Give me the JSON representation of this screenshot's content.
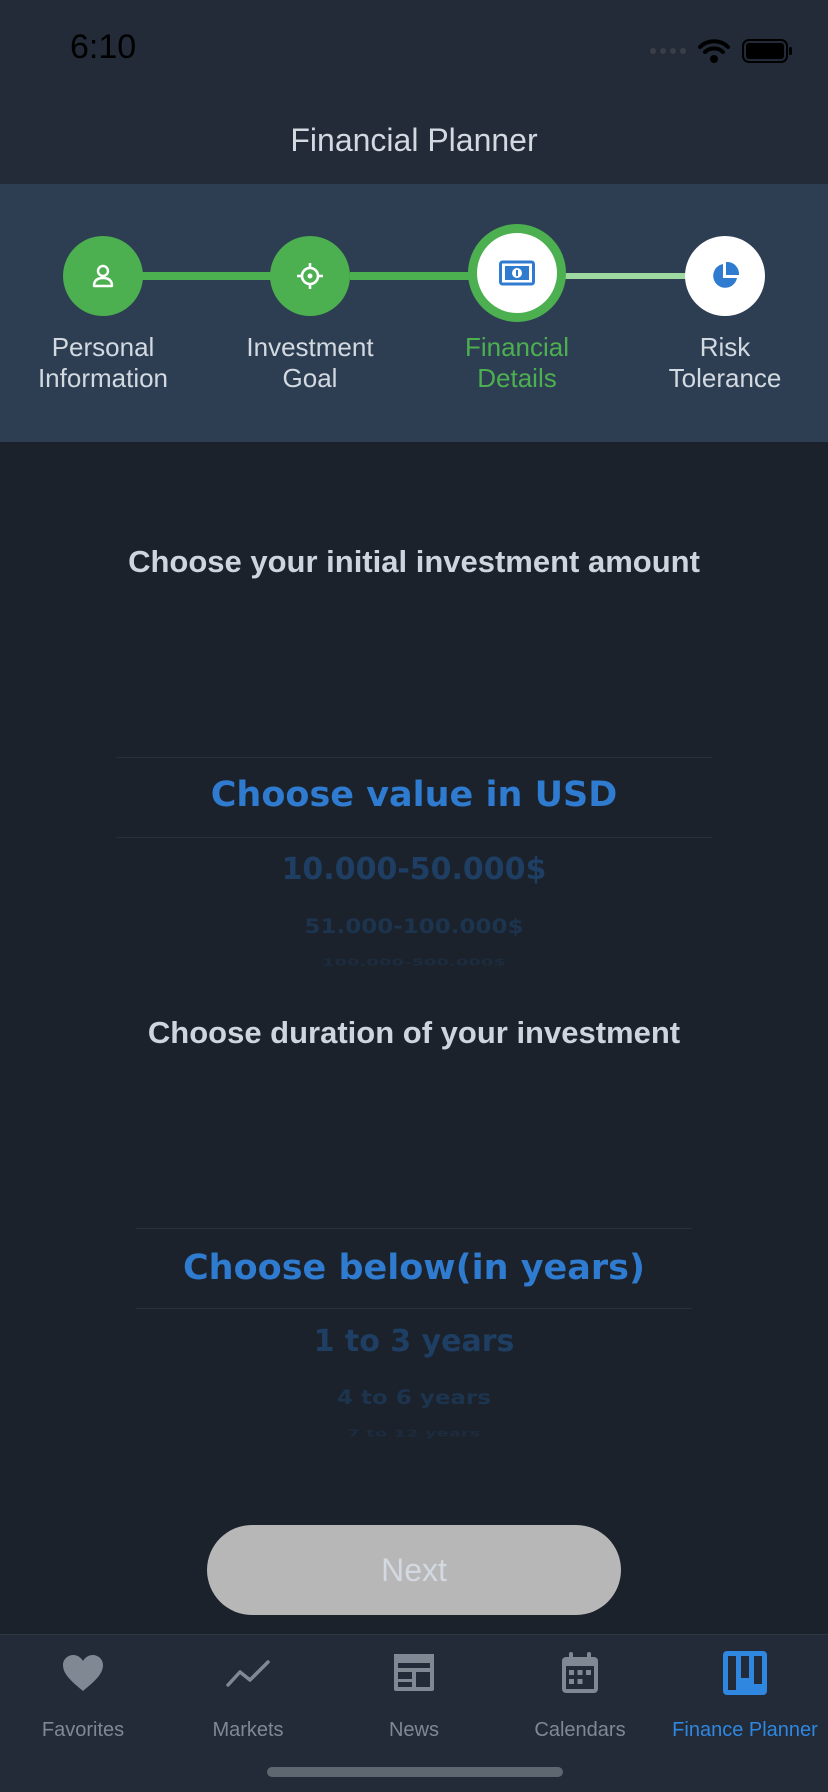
{
  "status_bar": {
    "time": "6:10"
  },
  "header": {
    "title": "Financial Planner"
  },
  "stepper": {
    "steps": [
      {
        "label": "Personal Information",
        "icon": "person-icon",
        "state": "done"
      },
      {
        "label": "Investment Goal",
        "icon": "crosshair-icon",
        "state": "done"
      },
      {
        "label": "Financial Details",
        "icon": "banknote-icon",
        "state": "active"
      },
      {
        "label": "Risk Tolerance",
        "icon": "pie-chart-icon",
        "state": "pending"
      }
    ],
    "colors": {
      "done": "#4caf50",
      "pending_line": "#9fd9a2",
      "accent": "#2f7bd0"
    }
  },
  "amount_section": {
    "title": "Choose your initial investment amount",
    "picker": {
      "selected": "Choose value in USD",
      "options": [
        "10.000-50.000$",
        "51.000-100.000$",
        "100.000-500.000$"
      ]
    }
  },
  "duration_section": {
    "title": "Choose duration of your investment",
    "picker": {
      "selected": "Choose below(in years)",
      "options": [
        "1 to 3 years",
        "4 to 6 years",
        "7 to 12 years"
      ]
    }
  },
  "next_button": {
    "label": "Next"
  },
  "tab_bar": {
    "tabs": [
      {
        "label": "Favorites",
        "icon": "heart-icon",
        "active": false
      },
      {
        "label": "Markets",
        "icon": "trend-line-icon",
        "active": false
      },
      {
        "label": "News",
        "icon": "newspaper-icon",
        "active": false
      },
      {
        "label": "Calendars",
        "icon": "calendar-icon",
        "active": false
      },
      {
        "label": "Finance Planner",
        "icon": "kanban-board-icon",
        "active": true
      }
    ]
  }
}
